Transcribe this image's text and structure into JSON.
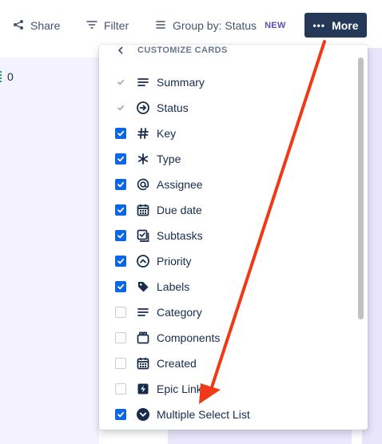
{
  "toolbar": {
    "share_label": "Share",
    "filter_label": "Filter",
    "group_label": "Group by: Status",
    "new_badge": "NEW",
    "more_label": "More"
  },
  "board": {
    "left_count": "0"
  },
  "panel": {
    "back_icon": "chevron-left-icon",
    "title": "CUSTOMIZE CARDS",
    "options": [
      {
        "label": "Summary",
        "state": "disabled",
        "icon": "lines-icon"
      },
      {
        "label": "Status",
        "state": "disabled",
        "icon": "arrow-circle-icon"
      },
      {
        "label": "Key",
        "state": "checked",
        "icon": "hash-icon"
      },
      {
        "label": "Type",
        "state": "checked",
        "icon": "asterisk-icon"
      },
      {
        "label": "Assignee",
        "state": "checked",
        "icon": "at-icon"
      },
      {
        "label": "Due date",
        "state": "checked",
        "icon": "calendar-icon"
      },
      {
        "label": "Subtasks",
        "state": "checked",
        "icon": "subtasks-icon"
      },
      {
        "label": "Priority",
        "state": "checked",
        "icon": "priority-icon"
      },
      {
        "label": "Labels",
        "state": "checked",
        "icon": "tag-icon"
      },
      {
        "label": "Category",
        "state": "unchecked",
        "icon": "lines-icon"
      },
      {
        "label": "Components",
        "state": "unchecked",
        "icon": "components-icon"
      },
      {
        "label": "Created",
        "state": "unchecked",
        "icon": "calendar-icon"
      },
      {
        "label": "Epic Link",
        "state": "unchecked",
        "icon": "lightning-icon"
      },
      {
        "label": "Multiple Select List",
        "state": "checked",
        "icon": "chevron-circle-icon"
      }
    ]
  },
  "colors": {
    "accent": "#0c66e4",
    "more_button": "#253858",
    "annotation_arrow": "#f03a17"
  }
}
